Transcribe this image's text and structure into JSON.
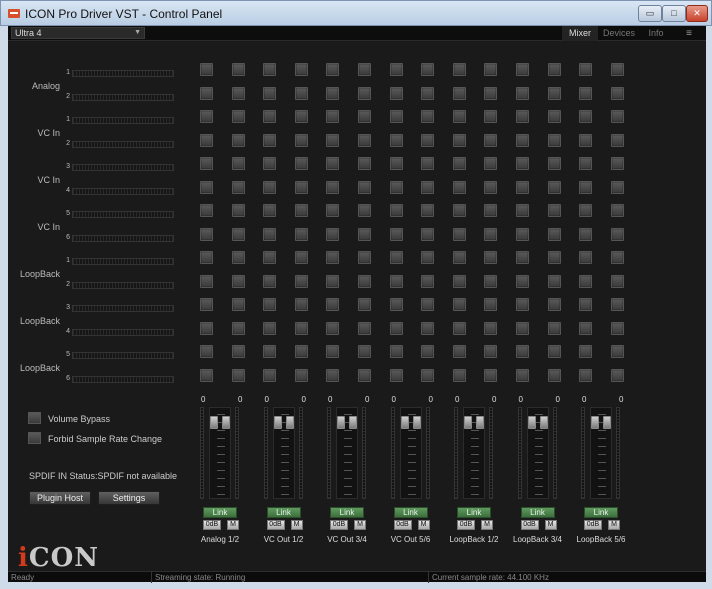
{
  "window": {
    "title": "ICON Pro Driver VST - Control Panel"
  },
  "topbar": {
    "device": "Ultra 4",
    "tabs": [
      {
        "label": "Mixer",
        "active": true
      },
      {
        "label": "Devices",
        "active": false
      },
      {
        "label": "Info",
        "active": false
      }
    ],
    "menu_glyph": "≡"
  },
  "inputs": [
    {
      "label": "Analog",
      "channels": [
        "1",
        "2"
      ]
    },
    {
      "label": "VC In",
      "channels": [
        "1",
        "2"
      ]
    },
    {
      "label": "VC In",
      "channels": [
        "3",
        "4"
      ]
    },
    {
      "label": "VC In",
      "channels": [
        "5",
        "6"
      ]
    },
    {
      "label": "LoopBack",
      "channels": [
        "1",
        "2"
      ]
    },
    {
      "label": "LoopBack",
      "channels": [
        "3",
        "4"
      ]
    },
    {
      "label": "LoopBack",
      "channels": [
        "5",
        "6"
      ]
    }
  ],
  "matrix": {
    "rows": 14,
    "cols": 14
  },
  "outputs": [
    {
      "name": "Analog 1/2",
      "left": "0",
      "right": "0",
      "link": "Link",
      "zero": "0dB",
      "mute": "M"
    },
    {
      "name": "VC Out 1/2",
      "left": "0",
      "right": "0",
      "link": "Link",
      "zero": "0dB",
      "mute": "M"
    },
    {
      "name": "VC Out 3/4",
      "left": "0",
      "right": "0",
      "link": "Link",
      "zero": "0dB",
      "mute": "M"
    },
    {
      "name": "VC Out 5/6",
      "left": "0",
      "right": "0",
      "link": "Link",
      "zero": "0dB",
      "mute": "M"
    },
    {
      "name": "LoopBack 1/2",
      "left": "0",
      "right": "0",
      "link": "Link",
      "zero": "0dB",
      "mute": "M"
    },
    {
      "name": "LoopBack 3/4",
      "left": "0",
      "right": "0",
      "link": "Link",
      "zero": "0dB",
      "mute": "M"
    },
    {
      "name": "LoopBack 5/6",
      "left": "0",
      "right": "0",
      "link": "Link",
      "zero": "0dB",
      "mute": "M"
    }
  ],
  "options": {
    "volume_bypass": "Volume Bypass",
    "forbid_rate_change": "Forbid Sample Rate Change",
    "spdif_status": "SPDIF IN Status:SPDIF not available",
    "plugin_host": "Plugin Host",
    "settings": "Settings"
  },
  "logo": {
    "text": "CON",
    "mark": "i"
  },
  "status": {
    "ready": "Ready",
    "streaming": "Streaming state: Running",
    "sample_rate": "Current sample rate: 44.100 KHz"
  },
  "colors": {
    "accent": "#d23a1e",
    "link_green": "#4f8a4f",
    "background": "#1a1a1a"
  }
}
